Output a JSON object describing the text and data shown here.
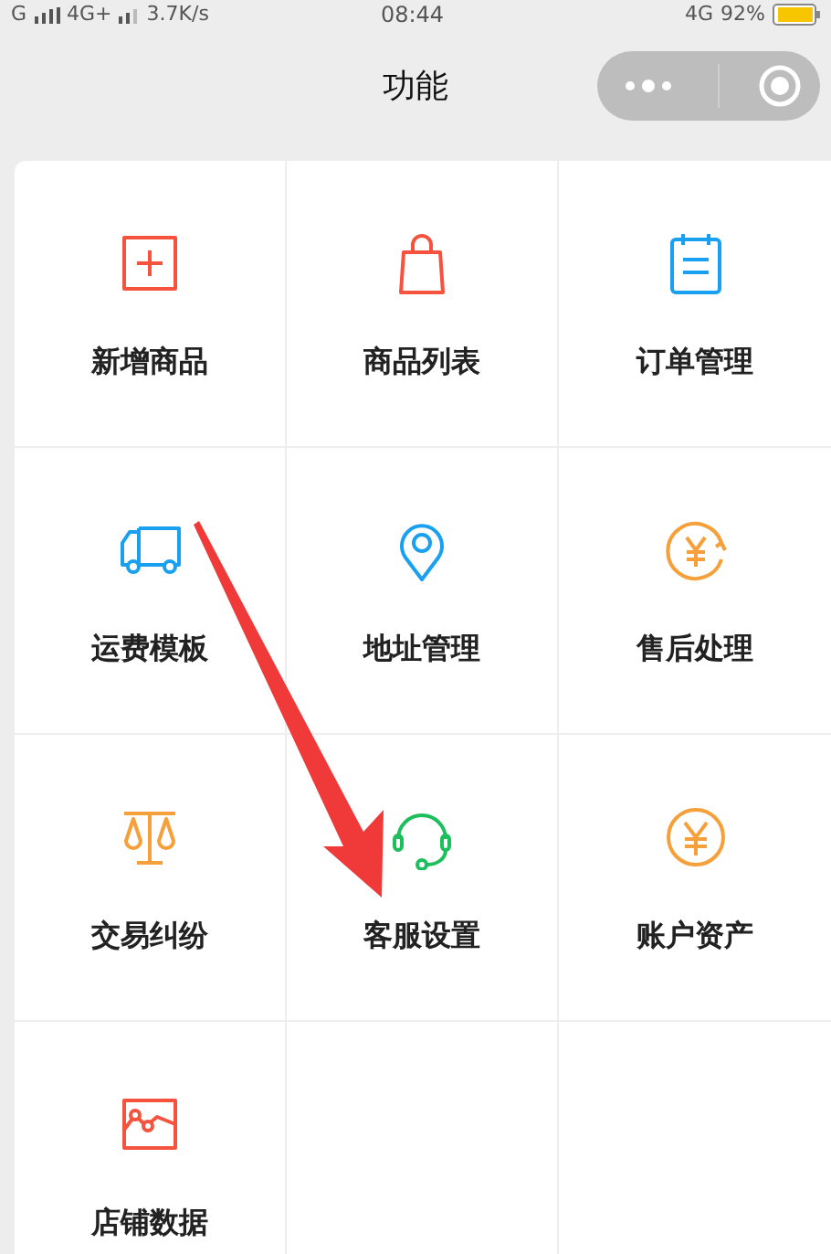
{
  "status_bar": {
    "network_left": "G",
    "network_right": "4G+",
    "speed": "3.7K/s",
    "time": "08:44",
    "network_status": "4G",
    "battery": "92%"
  },
  "nav": {
    "title": "功能"
  },
  "functions": [
    {
      "label": "新增商品",
      "kind": "add",
      "color": "#f5533d"
    },
    {
      "label": "商品列表",
      "kind": "bag",
      "color": "#f5533d"
    },
    {
      "label": "订单管理",
      "kind": "notepad",
      "color": "#1aa0f0"
    },
    {
      "label": "运费模板",
      "kind": "truck",
      "color": "#1aa0f0"
    },
    {
      "label": "地址管理",
      "kind": "pin",
      "color": "#1aa0f0"
    },
    {
      "label": "售后处理",
      "kind": "refund",
      "color": "#f5a03a"
    },
    {
      "label": "交易纠纷",
      "kind": "scale",
      "color": "#f5a03a"
    },
    {
      "label": "客服设置",
      "kind": "headset",
      "color": "#1dbf5c"
    },
    {
      "label": "账户资产",
      "kind": "yen",
      "color": "#f5a03a"
    },
    {
      "label": "店铺数据",
      "kind": "chart",
      "color": "#f5533d"
    },
    {
      "kind": "empty"
    },
    {
      "kind": "empty"
    }
  ],
  "annotation": {
    "kind": "arrow"
  }
}
